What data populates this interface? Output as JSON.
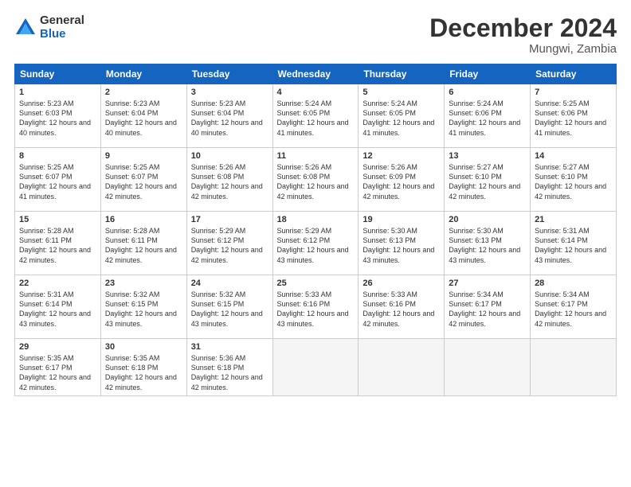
{
  "logo": {
    "general": "General",
    "blue": "Blue"
  },
  "title": "December 2024",
  "location": "Mungwi, Zambia",
  "days_of_week": [
    "Sunday",
    "Monday",
    "Tuesday",
    "Wednesday",
    "Thursday",
    "Friday",
    "Saturday"
  ],
  "weeks": [
    [
      {
        "day": "1",
        "sunrise": "5:23 AM",
        "sunset": "6:03 PM",
        "daylight": "12 hours and 40 minutes."
      },
      {
        "day": "2",
        "sunrise": "5:23 AM",
        "sunset": "6:04 PM",
        "daylight": "12 hours and 40 minutes."
      },
      {
        "day": "3",
        "sunrise": "5:23 AM",
        "sunset": "6:04 PM",
        "daylight": "12 hours and 40 minutes."
      },
      {
        "day": "4",
        "sunrise": "5:24 AM",
        "sunset": "6:05 PM",
        "daylight": "12 hours and 41 minutes."
      },
      {
        "day": "5",
        "sunrise": "5:24 AM",
        "sunset": "6:05 PM",
        "daylight": "12 hours and 41 minutes."
      },
      {
        "day": "6",
        "sunrise": "5:24 AM",
        "sunset": "6:06 PM",
        "daylight": "12 hours and 41 minutes."
      },
      {
        "day": "7",
        "sunrise": "5:25 AM",
        "sunset": "6:06 PM",
        "daylight": "12 hours and 41 minutes."
      }
    ],
    [
      {
        "day": "8",
        "sunrise": "5:25 AM",
        "sunset": "6:07 PM",
        "daylight": "12 hours and 41 minutes."
      },
      {
        "day": "9",
        "sunrise": "5:25 AM",
        "sunset": "6:07 PM",
        "daylight": "12 hours and 42 minutes."
      },
      {
        "day": "10",
        "sunrise": "5:26 AM",
        "sunset": "6:08 PM",
        "daylight": "12 hours and 42 minutes."
      },
      {
        "day": "11",
        "sunrise": "5:26 AM",
        "sunset": "6:08 PM",
        "daylight": "12 hours and 42 minutes."
      },
      {
        "day": "12",
        "sunrise": "5:26 AM",
        "sunset": "6:09 PM",
        "daylight": "12 hours and 42 minutes."
      },
      {
        "day": "13",
        "sunrise": "5:27 AM",
        "sunset": "6:10 PM",
        "daylight": "12 hours and 42 minutes."
      },
      {
        "day": "14",
        "sunrise": "5:27 AM",
        "sunset": "6:10 PM",
        "daylight": "12 hours and 42 minutes."
      }
    ],
    [
      {
        "day": "15",
        "sunrise": "5:28 AM",
        "sunset": "6:11 PM",
        "daylight": "12 hours and 42 minutes."
      },
      {
        "day": "16",
        "sunrise": "5:28 AM",
        "sunset": "6:11 PM",
        "daylight": "12 hours and 42 minutes."
      },
      {
        "day": "17",
        "sunrise": "5:29 AM",
        "sunset": "6:12 PM",
        "daylight": "12 hours and 42 minutes."
      },
      {
        "day": "18",
        "sunrise": "5:29 AM",
        "sunset": "6:12 PM",
        "daylight": "12 hours and 43 minutes."
      },
      {
        "day": "19",
        "sunrise": "5:30 AM",
        "sunset": "6:13 PM",
        "daylight": "12 hours and 43 minutes."
      },
      {
        "day": "20",
        "sunrise": "5:30 AM",
        "sunset": "6:13 PM",
        "daylight": "12 hours and 43 minutes."
      },
      {
        "day": "21",
        "sunrise": "5:31 AM",
        "sunset": "6:14 PM",
        "daylight": "12 hours and 43 minutes."
      }
    ],
    [
      {
        "day": "22",
        "sunrise": "5:31 AM",
        "sunset": "6:14 PM",
        "daylight": "12 hours and 43 minutes."
      },
      {
        "day": "23",
        "sunrise": "5:32 AM",
        "sunset": "6:15 PM",
        "daylight": "12 hours and 43 minutes."
      },
      {
        "day": "24",
        "sunrise": "5:32 AM",
        "sunset": "6:15 PM",
        "daylight": "12 hours and 43 minutes."
      },
      {
        "day": "25",
        "sunrise": "5:33 AM",
        "sunset": "6:16 PM",
        "daylight": "12 hours and 43 minutes."
      },
      {
        "day": "26",
        "sunrise": "5:33 AM",
        "sunset": "6:16 PM",
        "daylight": "12 hours and 42 minutes."
      },
      {
        "day": "27",
        "sunrise": "5:34 AM",
        "sunset": "6:17 PM",
        "daylight": "12 hours and 42 minutes."
      },
      {
        "day": "28",
        "sunrise": "5:34 AM",
        "sunset": "6:17 PM",
        "daylight": "12 hours and 42 minutes."
      }
    ],
    [
      {
        "day": "29",
        "sunrise": "5:35 AM",
        "sunset": "6:17 PM",
        "daylight": "12 hours and 42 minutes."
      },
      {
        "day": "30",
        "sunrise": "5:35 AM",
        "sunset": "6:18 PM",
        "daylight": "12 hours and 42 minutes."
      },
      {
        "day": "31",
        "sunrise": "5:36 AM",
        "sunset": "6:18 PM",
        "daylight": "12 hours and 42 minutes."
      },
      null,
      null,
      null,
      null
    ]
  ]
}
